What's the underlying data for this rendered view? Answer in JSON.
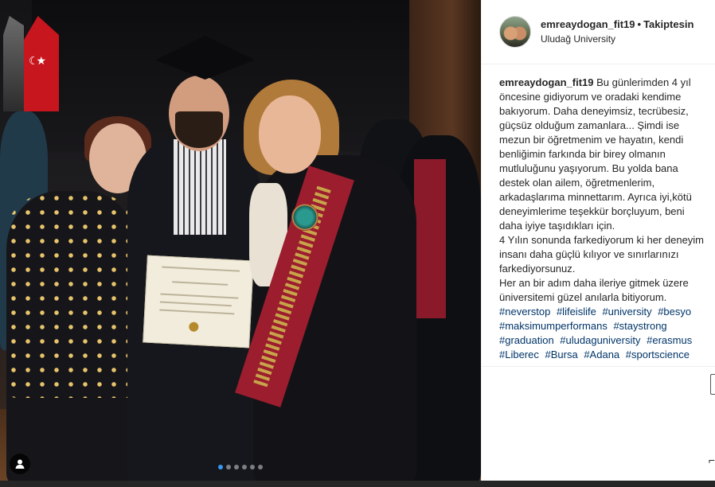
{
  "post": {
    "username": "emreaydogan_fit19",
    "separator": "•",
    "follow_status": "Takiptesin",
    "location": "Uludağ University",
    "caption_author": "emreaydogan_fit19",
    "caption_text": " Bu günlerimden 4 yıl öncesine gidiyorum ve oradaki kendime bakıyorum. Daha deneyimsiz, tecrübesiz, güçsüz olduğum zamanlara... Şimdi ise mezun bir öğretmenim ve hayatın, kendi benliğimin farkında bir birey olmanın mutluluğunu yaşıyorum. Bu yolda bana destek olan ailem, öğretmenlerim, arkadaşlarıma minnettarım. Ayrıca iyi,kötü deneyimlerime teşekkür borçluyum, beni daha iyiye taşıdıkları için.\n4 Yılın sonunda farkediyorum ki her deneyim insanı daha güçlü kılıyor ve sınırlarınızı farkediyorsunuz.\nHer an bir adım daha ileriye gitmek üzere üniversitemi güzel anılarla bitiyorum.",
    "hashtags": [
      "#neverstop",
      "#lifeislife",
      "#university",
      "#besyo",
      "#maksimumperformans",
      "#staystrong",
      "#graduation",
      "#uludaguniversity",
      "#erasmus",
      "#Liberec",
      "#Bursa",
      "#Adana",
      "#sportscience"
    ]
  },
  "carousel": {
    "total": 6,
    "active_index": 1
  },
  "icons": {
    "tag": "user-tag-icon",
    "scroll": "scroll-handle-icon",
    "more": "more-glyph-icon"
  },
  "colors": {
    "accent": "#3897f0",
    "hashtag": "#003569",
    "text": "#262626"
  }
}
